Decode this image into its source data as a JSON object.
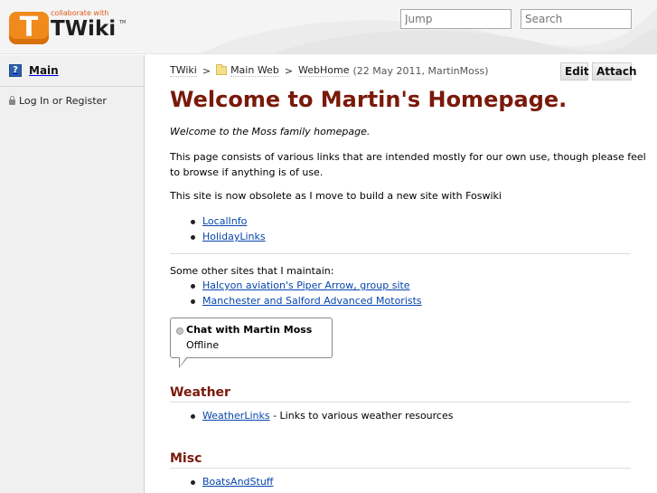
{
  "header": {
    "logo": {
      "badge_letter": "T",
      "tagline": "collaborate with",
      "name": "TWiki",
      "tm": "TM"
    },
    "jump": {
      "placeholder": "Jump"
    },
    "search": {
      "placeholder": "Search"
    }
  },
  "sidebar": {
    "web_icon_glyph": "?",
    "web_name": "Main",
    "login_label": "Log In",
    "or_text": "or",
    "register_label": "Register"
  },
  "breadcrumb": {
    "root": "TWiki",
    "web": "Main Web",
    "topic": "WebHome",
    "revision": "(22 May 2011, MartinMoss)",
    "separator": ">"
  },
  "actions": {
    "edit_label": "Edit",
    "attach_label": "Attach"
  },
  "content": {
    "title": "Welcome to Martin's Homepage.",
    "intro": "Welcome to the Moss family homepage.",
    "description": "This page consists of various links that are intended mostly for our own use, though please feel to browse if anything is of use.",
    "obsolete_note": "This site is now obsolete as I move to build a new site with Foswiki",
    "main_links": [
      "LocalInfo",
      "HolidayLinks"
    ],
    "other_sites_heading": "Some other sites that I maintain:",
    "other_sites": [
      "Halcyon aviation's Piper Arrow, group site",
      "Manchester and Salford Advanced Motorists"
    ],
    "chat": {
      "title": "Chat with Martin Moss",
      "status": "Offline"
    },
    "weather": {
      "heading": "Weather",
      "link": "WeatherLinks",
      "suffix": " - Links to various weather resources"
    },
    "misc": {
      "heading": "Misc",
      "link": "BoatsAndStuff"
    }
  },
  "colors": {
    "heading": "#7a1a0a",
    "link": "#0645ad",
    "logo_orange": "#f08a1c"
  }
}
